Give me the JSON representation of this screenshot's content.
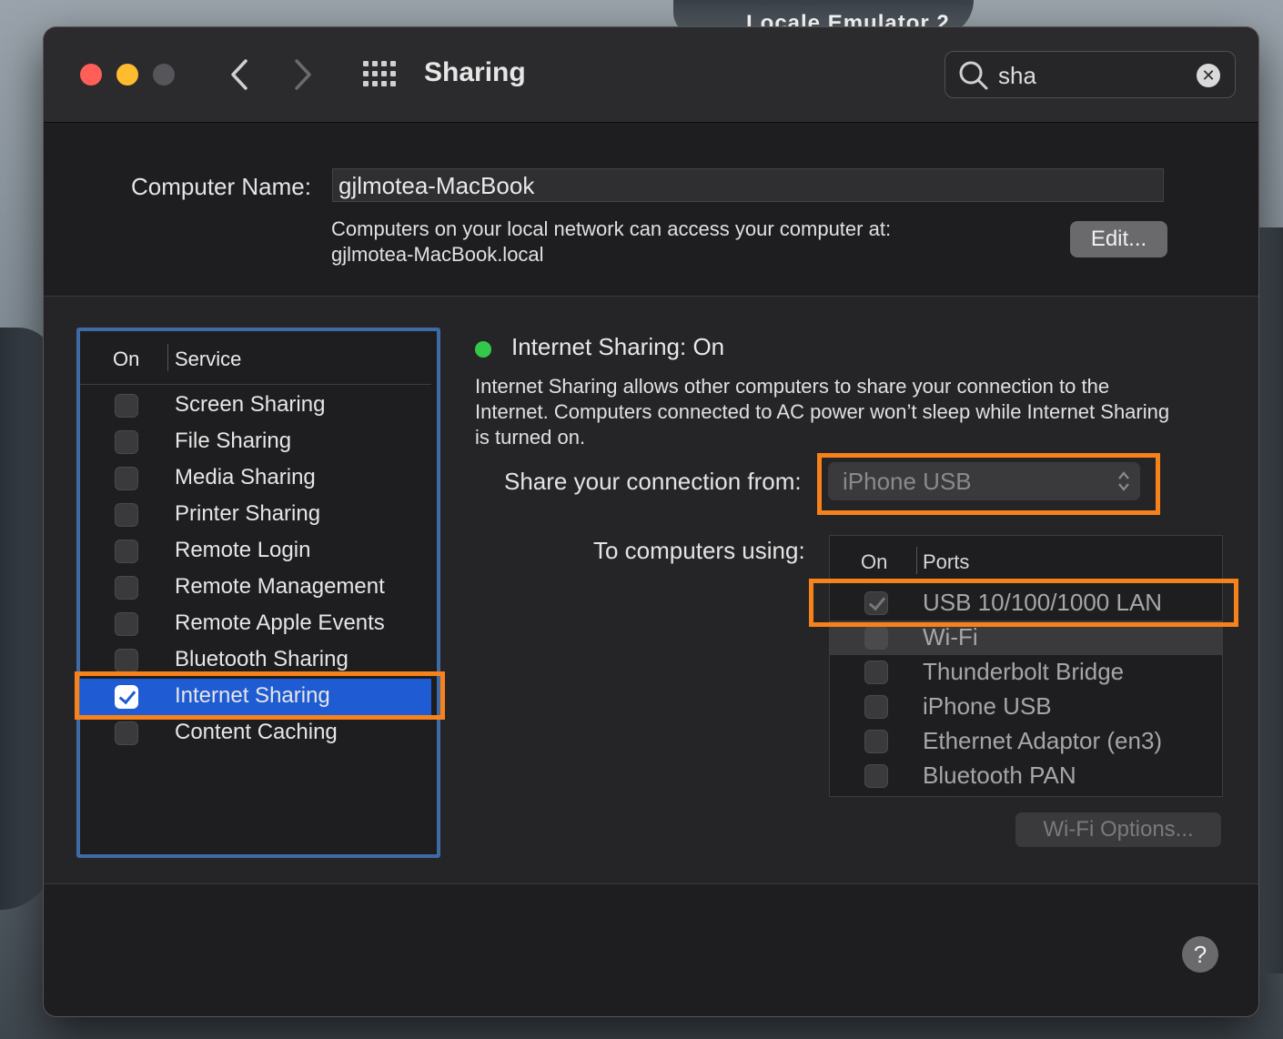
{
  "desktop": {
    "background_label": "Locale Emulator 2"
  },
  "titlebar": {
    "title": "Sharing",
    "back_icon": "chevron-left-icon",
    "forward_icon": "chevron-right-icon",
    "grid_icon": "show-all-grid-icon",
    "search": {
      "value": "sha",
      "clear_label": "✕"
    }
  },
  "computer": {
    "name_label": "Computer Name:",
    "name_value": "gjlmotea-MacBook",
    "access_line1": "Computers on your local network can access your computer at:",
    "access_line2": "gjlmotea-MacBook.local",
    "edit_label": "Edit..."
  },
  "services": {
    "header_on": "On",
    "header_service": "Service",
    "items": [
      {
        "label": "Screen Sharing",
        "checked": false
      },
      {
        "label": "File Sharing",
        "checked": false
      },
      {
        "label": "Media Sharing",
        "checked": false
      },
      {
        "label": "Printer Sharing",
        "checked": false
      },
      {
        "label": "Remote Login",
        "checked": false
      },
      {
        "label": "Remote Management",
        "checked": false
      },
      {
        "label": "Remote Apple Events",
        "checked": false
      },
      {
        "label": "Bluetooth Sharing",
        "checked": false
      },
      {
        "label": "Internet Sharing",
        "checked": true,
        "selected": true
      },
      {
        "label": "Content Caching",
        "checked": false
      }
    ]
  },
  "detail": {
    "status": "Internet Sharing: On",
    "status_color": "#34c84a",
    "description": "Internet Sharing allows other computers to share your connection to the Internet. Computers connected to AC power won’t sleep while Internet Sharing is turned on.",
    "share_from_label": "Share your connection from:",
    "share_from_value": "iPhone USB",
    "to_label": "To computers using:",
    "ports_header_on": "On",
    "ports_header_ports": "Ports",
    "ports": [
      {
        "label": "USB 10/100/1000 LAN",
        "checked": true
      },
      {
        "label": "Wi-Fi",
        "checked": false
      },
      {
        "label": "Thunderbolt Bridge",
        "checked": false
      },
      {
        "label": "iPhone USB",
        "checked": false
      },
      {
        "label": "Ethernet Adaptor (en3)",
        "checked": false
      },
      {
        "label": "Bluetooth PAN",
        "checked": false
      }
    ],
    "wifi_options_label": "Wi-Fi Options..."
  },
  "help_label": "?",
  "colors": {
    "highlight": "#f7821b",
    "list_border": "#3e6aa6",
    "selection": "#1f5bd3"
  }
}
